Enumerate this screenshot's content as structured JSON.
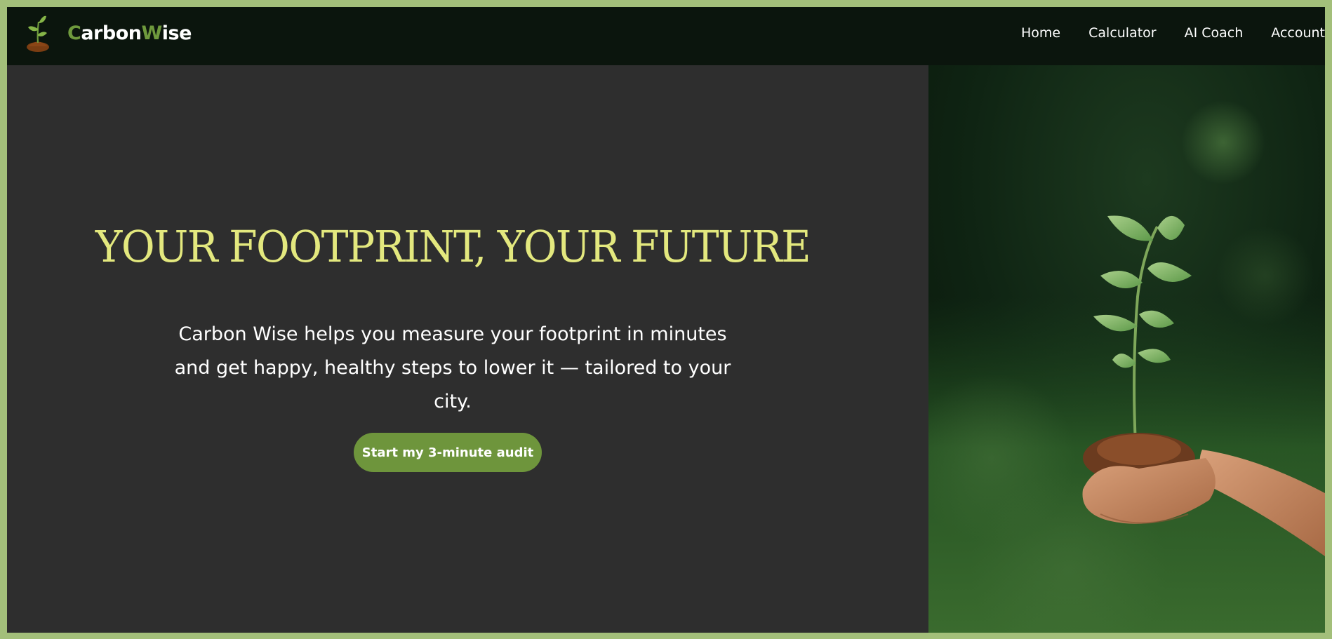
{
  "brand": {
    "name_first_letter": "C",
    "name_part1": "arbon",
    "name_second_letter": "W",
    "name_part2": "ise",
    "logo_icon": "sprout-in-soil-icon",
    "accent_color": "#6f9a3d"
  },
  "nav": {
    "items": [
      {
        "label": "Home"
      },
      {
        "label": "Calculator"
      },
      {
        "label": "AI Coach"
      },
      {
        "label": "Account"
      }
    ]
  },
  "hero": {
    "title": "YOUR FOOTPRINT, YOUR FUTURE",
    "description": "Carbon Wise helps you measure your footprint in minutes and get happy, healthy steps to lower it — tailored to your city.",
    "cta_label": "Start my 3-minute audit",
    "image_subject": "hands-holding-sapling-image"
  },
  "colors": {
    "page_border": "#a3bf7a",
    "navbar_bg": "#0b150d",
    "hero_bg": "#2e2e2e",
    "title_color": "#e3e87e",
    "cta_bg": "#6e953c"
  }
}
